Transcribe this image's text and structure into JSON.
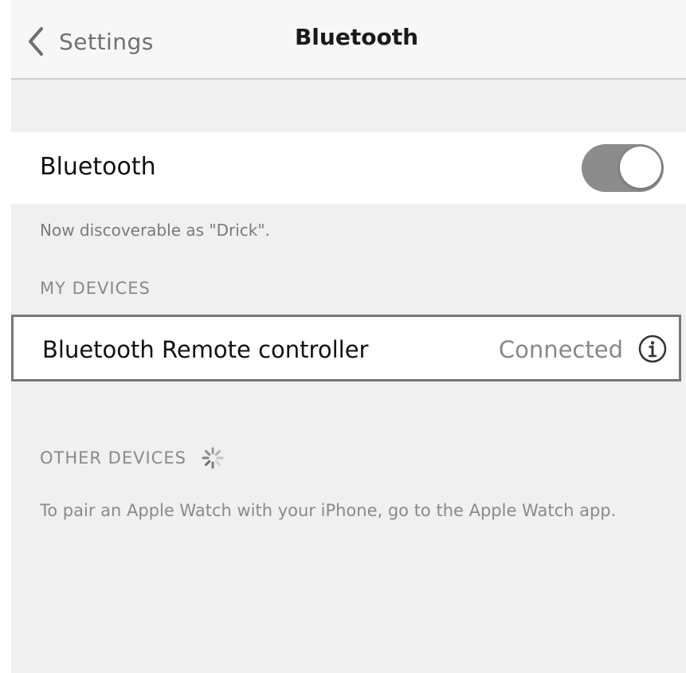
{
  "nav": {
    "back_label": "Settings",
    "title": "Bluetooth"
  },
  "bluetooth": {
    "label": "Bluetooth",
    "enabled": true,
    "discoverable_text": "Now discoverable as \"Drick\"."
  },
  "my_devices": {
    "header": "MY DEVICES",
    "items": [
      {
        "name": "Bluetooth Remote controller",
        "status": "Connected",
        "icon": "info-icon"
      }
    ]
  },
  "other_devices": {
    "header": "OTHER DEVICES",
    "icon": "spinner-icon",
    "note": "To pair an Apple Watch with your iPhone, go to the Apple Watch app."
  },
  "colors": {
    "toggle_on": "#8c8c8c",
    "background": "#f0f0f0",
    "row": "#ffffff",
    "highlight_border": "#777777"
  }
}
